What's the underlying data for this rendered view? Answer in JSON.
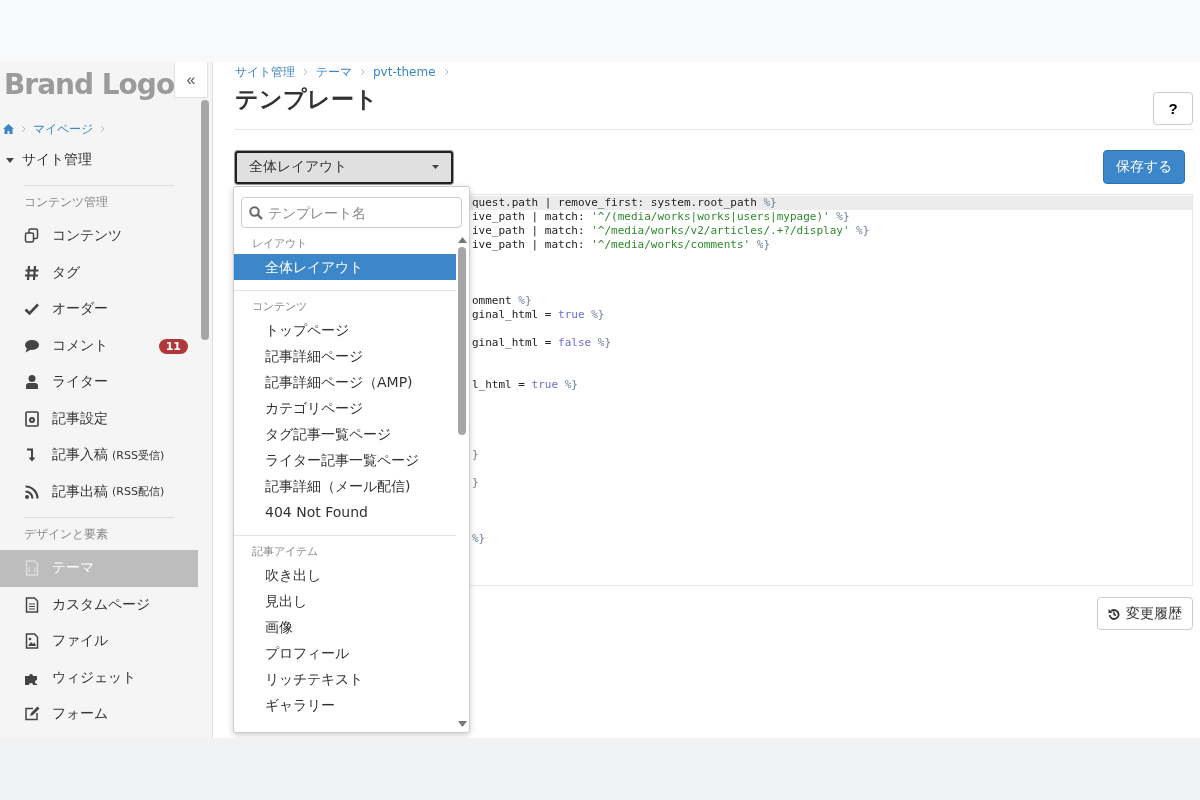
{
  "sidebar": {
    "logo": "Brand Logo",
    "collapse_button": "«",
    "breadcrumb": [
      "マイページ"
    ],
    "section": {
      "label": "サイト管理",
      "expanded": true
    },
    "groups": [
      {
        "heading": "コンテンツ管理",
        "items": [
          {
            "kind": "copy",
            "label": "コンテンツ",
            "selected": false
          },
          {
            "kind": "hash",
            "label": "タグ",
            "selected": false
          },
          {
            "kind": "check",
            "label": "オーダー",
            "selected": false
          },
          {
            "kind": "comment",
            "label": "コメント",
            "badge": "11",
            "selected": false
          },
          {
            "kind": "user",
            "label": "ライター",
            "selected": false
          },
          {
            "kind": "settings",
            "label": "記事設定",
            "selected": false
          },
          {
            "kind": "import",
            "label": "記事入稿",
            "note": "(RSS受信)",
            "selected": false
          },
          {
            "kind": "rss",
            "label": "記事出稿",
            "note": "(RSS配信)",
            "selected": false
          }
        ]
      },
      {
        "heading": "デザインと要素",
        "items": [
          {
            "kind": "theme",
            "label": "テーマ",
            "selected": true
          },
          {
            "kind": "page",
            "label": "カスタムページ",
            "selected": false
          },
          {
            "kind": "file",
            "label": "ファイル",
            "selected": false
          },
          {
            "kind": "widget",
            "label": "ウィジェット",
            "selected": false
          },
          {
            "kind": "form",
            "label": "フォーム",
            "selected": false
          }
        ]
      }
    ]
  },
  "breadcrumb": [
    "サイト管理",
    "テーマ",
    "pvt-theme"
  ],
  "title": "テンプレート",
  "help_button": "?",
  "template_select": {
    "value": "全体レイアウト",
    "expanded": true
  },
  "save_button": "保存する",
  "dropdown": {
    "search": {
      "placeholder": "テンプレート名"
    },
    "groups": [
      {
        "heading": "レイアウト",
        "items": [
          {
            "label": "全体レイアウト",
            "selected": true
          }
        ]
      },
      {
        "heading": "コンテンツ",
        "items": [
          {
            "label": "トップページ",
            "selected": false
          },
          {
            "label": "記事詳細ページ",
            "selected": false
          },
          {
            "label": "記事詳細ページ（AMP)",
            "selected": false
          },
          {
            "label": "カテゴリページ",
            "selected": false
          },
          {
            "label": "タグ記事一覧ページ",
            "selected": false
          },
          {
            "label": "ライター記事一覧ページ",
            "selected": false
          },
          {
            "label": "記事詳細（メール配信)",
            "selected": false
          },
          {
            "label": "404 Not Found",
            "selected": false
          }
        ]
      },
      {
        "heading": "記事アイテム",
        "items": [
          {
            "label": "吹き出し",
            "selected": false
          },
          {
            "label": "見出し",
            "selected": false
          },
          {
            "label": "画像",
            "selected": false
          },
          {
            "label": "プロフィール",
            "selected": false
          },
          {
            "label": "リッチテキスト",
            "selected": false
          },
          {
            "label": "ギャラリー",
            "selected": false
          }
        ]
      }
    ]
  },
  "editor": {
    "lines": [
      {
        "kind": "code",
        "active": true,
        "tokens": [
          {
            "kind": "plain",
            "text": "quest.path | remove_first: system.root_path "
          },
          {
            "kind": "delim",
            "text": "%}"
          }
        ]
      },
      {
        "kind": "code",
        "active": false,
        "tokens": [
          {
            "kind": "plain",
            "text": "ive_path | match: "
          },
          {
            "kind": "string",
            "text": "'^/(media/works|works|users|mypage)'"
          },
          {
            "kind": "delim",
            "text": " %}"
          }
        ]
      },
      {
        "kind": "code",
        "active": false,
        "tokens": [
          {
            "kind": "plain",
            "text": "ive_path | match: "
          },
          {
            "kind": "string",
            "text": "'^/media/works/v2/articles/.+?/display'"
          },
          {
            "kind": "delim",
            "text": " %}"
          }
        ]
      },
      {
        "kind": "code",
        "active": false,
        "tokens": [
          {
            "kind": "plain",
            "text": "ive_path | match: "
          },
          {
            "kind": "string",
            "text": "'^/media/works/comments'"
          },
          {
            "kind": "delim",
            "text": " %}"
          }
        ]
      },
      {
        "kind": "blank"
      },
      {
        "kind": "blank"
      },
      {
        "kind": "blank"
      },
      {
        "kind": "code",
        "active": false,
        "tokens": [
          {
            "kind": "plain",
            "text": "omment "
          },
          {
            "kind": "delim",
            "text": "%}"
          }
        ]
      },
      {
        "kind": "code",
        "active": false,
        "tokens": [
          {
            "kind": "plain",
            "text": "ginal_html = "
          },
          {
            "kind": "keyword",
            "text": "true"
          },
          {
            "kind": "delim",
            "text": " %}"
          }
        ]
      },
      {
        "kind": "blank"
      },
      {
        "kind": "code",
        "active": false,
        "tokens": [
          {
            "kind": "plain",
            "text": "ginal_html = "
          },
          {
            "kind": "keyword",
            "text": "false"
          },
          {
            "kind": "delim",
            "text": " %}"
          }
        ]
      },
      {
        "kind": "blank"
      },
      {
        "kind": "blank"
      },
      {
        "kind": "code",
        "active": false,
        "tokens": [
          {
            "kind": "plain",
            "text": "l_html = "
          },
          {
            "kind": "keyword",
            "text": "true"
          },
          {
            "kind": "delim",
            "text": " %}"
          }
        ]
      },
      {
        "kind": "blank"
      },
      {
        "kind": "blank"
      },
      {
        "kind": "blank"
      },
      {
        "kind": "blank"
      },
      {
        "kind": "code",
        "active": false,
        "tokens": [
          {
            "kind": "delim",
            "text": "}"
          }
        ]
      },
      {
        "kind": "blank"
      },
      {
        "kind": "code",
        "active": false,
        "tokens": [
          {
            "kind": "delim",
            "text": "}"
          }
        ]
      },
      {
        "kind": "blank"
      },
      {
        "kind": "blank"
      },
      {
        "kind": "blank"
      },
      {
        "kind": "code",
        "active": false,
        "tokens": [
          {
            "kind": "delim",
            "text": "%}"
          }
        ]
      }
    ]
  },
  "history_button": "変更履歴"
}
